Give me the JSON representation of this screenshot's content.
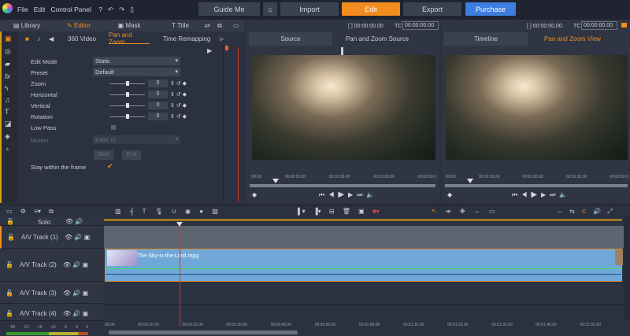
{
  "menu": {
    "items": [
      "File",
      "Edit",
      "Control Panel"
    ]
  },
  "topnav": {
    "guide": "Guide Me",
    "import": "Import",
    "edit": "Edit",
    "export": "Export",
    "purchase": "Purchase"
  },
  "colors": {
    "accent": "#f28c1e",
    "purchase": "#3d7ee0",
    "clip": "#6fa8d8"
  },
  "left_tabs": [
    "Library",
    "Editor",
    "Mask",
    "Title"
  ],
  "sub_tabs": [
    "360 Video",
    "Pan and Zoom",
    "Time Remapping"
  ],
  "props": {
    "edit_mode_label": "Edit Mode",
    "edit_mode": "Static",
    "preset_label": "Preset",
    "preset": "Default",
    "sliders": [
      {
        "label": "Zoom",
        "value": "0"
      },
      {
        "label": "Horizontal",
        "value": "0"
      },
      {
        "label": "Vertical",
        "value": "0"
      },
      {
        "label": "Rotation",
        "value": "0"
      }
    ],
    "low_pass": "Low Pass",
    "motion_label": "Motion",
    "motion": "Ease In",
    "start": "Start",
    "end": "End",
    "stay": "Stay within the frame"
  },
  "source": {
    "dur": "[ ] 00:00:00.00",
    "tc_label": "TC",
    "tc": "00:00:00.00",
    "tabs": [
      "Source",
      "Pan and Zoom Source"
    ],
    "ruler": [
      ":00.00",
      "00:00:30.00",
      "00:01:00.00",
      "00:01:30.00",
      "00:02:00.0"
    ]
  },
  "view": {
    "dur": "[ ] 00:00:00.00",
    "tc_label": "TC",
    "tc": "00:00:00.00",
    "tabs": [
      "Timeline",
      "Pan and Zoom View"
    ],
    "ruler": [
      ":00.00",
      "00:00:30.00",
      "00:01:00.00",
      "00:01:30.00",
      "00:02:00.0"
    ]
  },
  "timeline": {
    "solo": "Solo",
    "tracks": [
      "A/V Track (1)",
      "A/V Track (2)",
      "A/V Track (3)",
      "A/V Track (4)"
    ],
    "clip": "The-Sky-is-the-Limit.mpg",
    "ruler": [
      "00.00",
      "00:00:10.00",
      "00:00:20.00",
      "00:00:30.00",
      "00:00:40.00",
      "00:00:50.00",
      "00:01:00.00",
      "00:01:10.00",
      "00:01:20.00",
      "00:01:30.00",
      "00:01:40.00",
      "00:01:50.00"
    ],
    "meter": [
      "-60",
      "-22",
      "-16",
      "-10",
      "-6",
      "-3",
      "0"
    ]
  }
}
